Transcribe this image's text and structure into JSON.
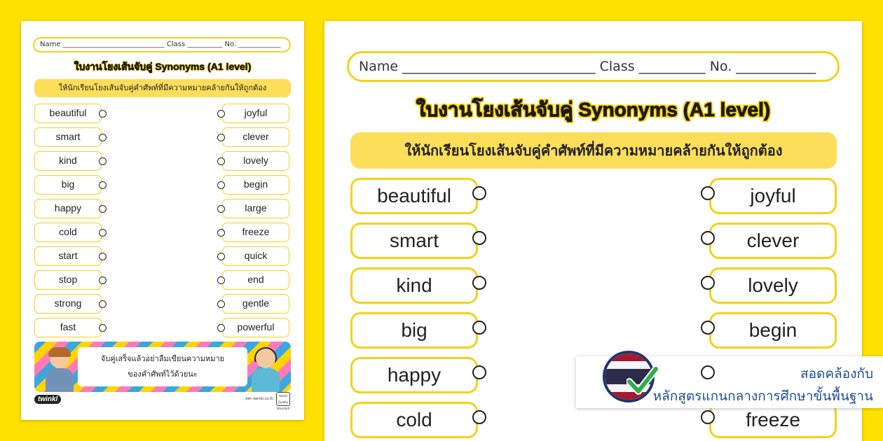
{
  "worksheet": {
    "name_line": "Name _____________________________ Class __________ No. ____________",
    "title": "ใบงานโยงเส้นจับคู่ Synonyms (A1 level)",
    "instruction": "ให้นักเรียนโยงเส้นจับคู่คำศัพท์ที่มีความหมายคล้ายกันให้ถูกต้อง",
    "left_words": [
      "beautiful",
      "smart",
      "kind",
      "big",
      "happy",
      "cold",
      "start",
      "stop",
      "strong",
      "fast"
    ],
    "right_words": [
      "joyful",
      "clever",
      "lovely",
      "begin",
      "large",
      "freeze",
      "quick",
      "end",
      "gentle",
      "powerful"
    ],
    "banner_text_line1": "จับคู่เสร็จแล้วอย่าลืมเขียนความหมาย",
    "banner_text_line2": "ของคำศัพท์ไว้ด้วยนะ",
    "logo": "twinkl",
    "footer_url": "หลัก twinkl.co.th",
    "badge_text": "twinkl Quality Standard"
  },
  "overlay": {
    "line1": "สอดคล้องกับ",
    "line2": "หลักสูตรแกนกลางการศึกษาขั้นพื้นฐาน",
    "flag_icon": "thai-flag-icon",
    "check_icon": "check-icon",
    "flag_colors": [
      "#a51931",
      "#f4f5f8",
      "#2d2a4a",
      "#f4f5f8",
      "#a51931"
    ],
    "check_color": "#2fae4a"
  }
}
